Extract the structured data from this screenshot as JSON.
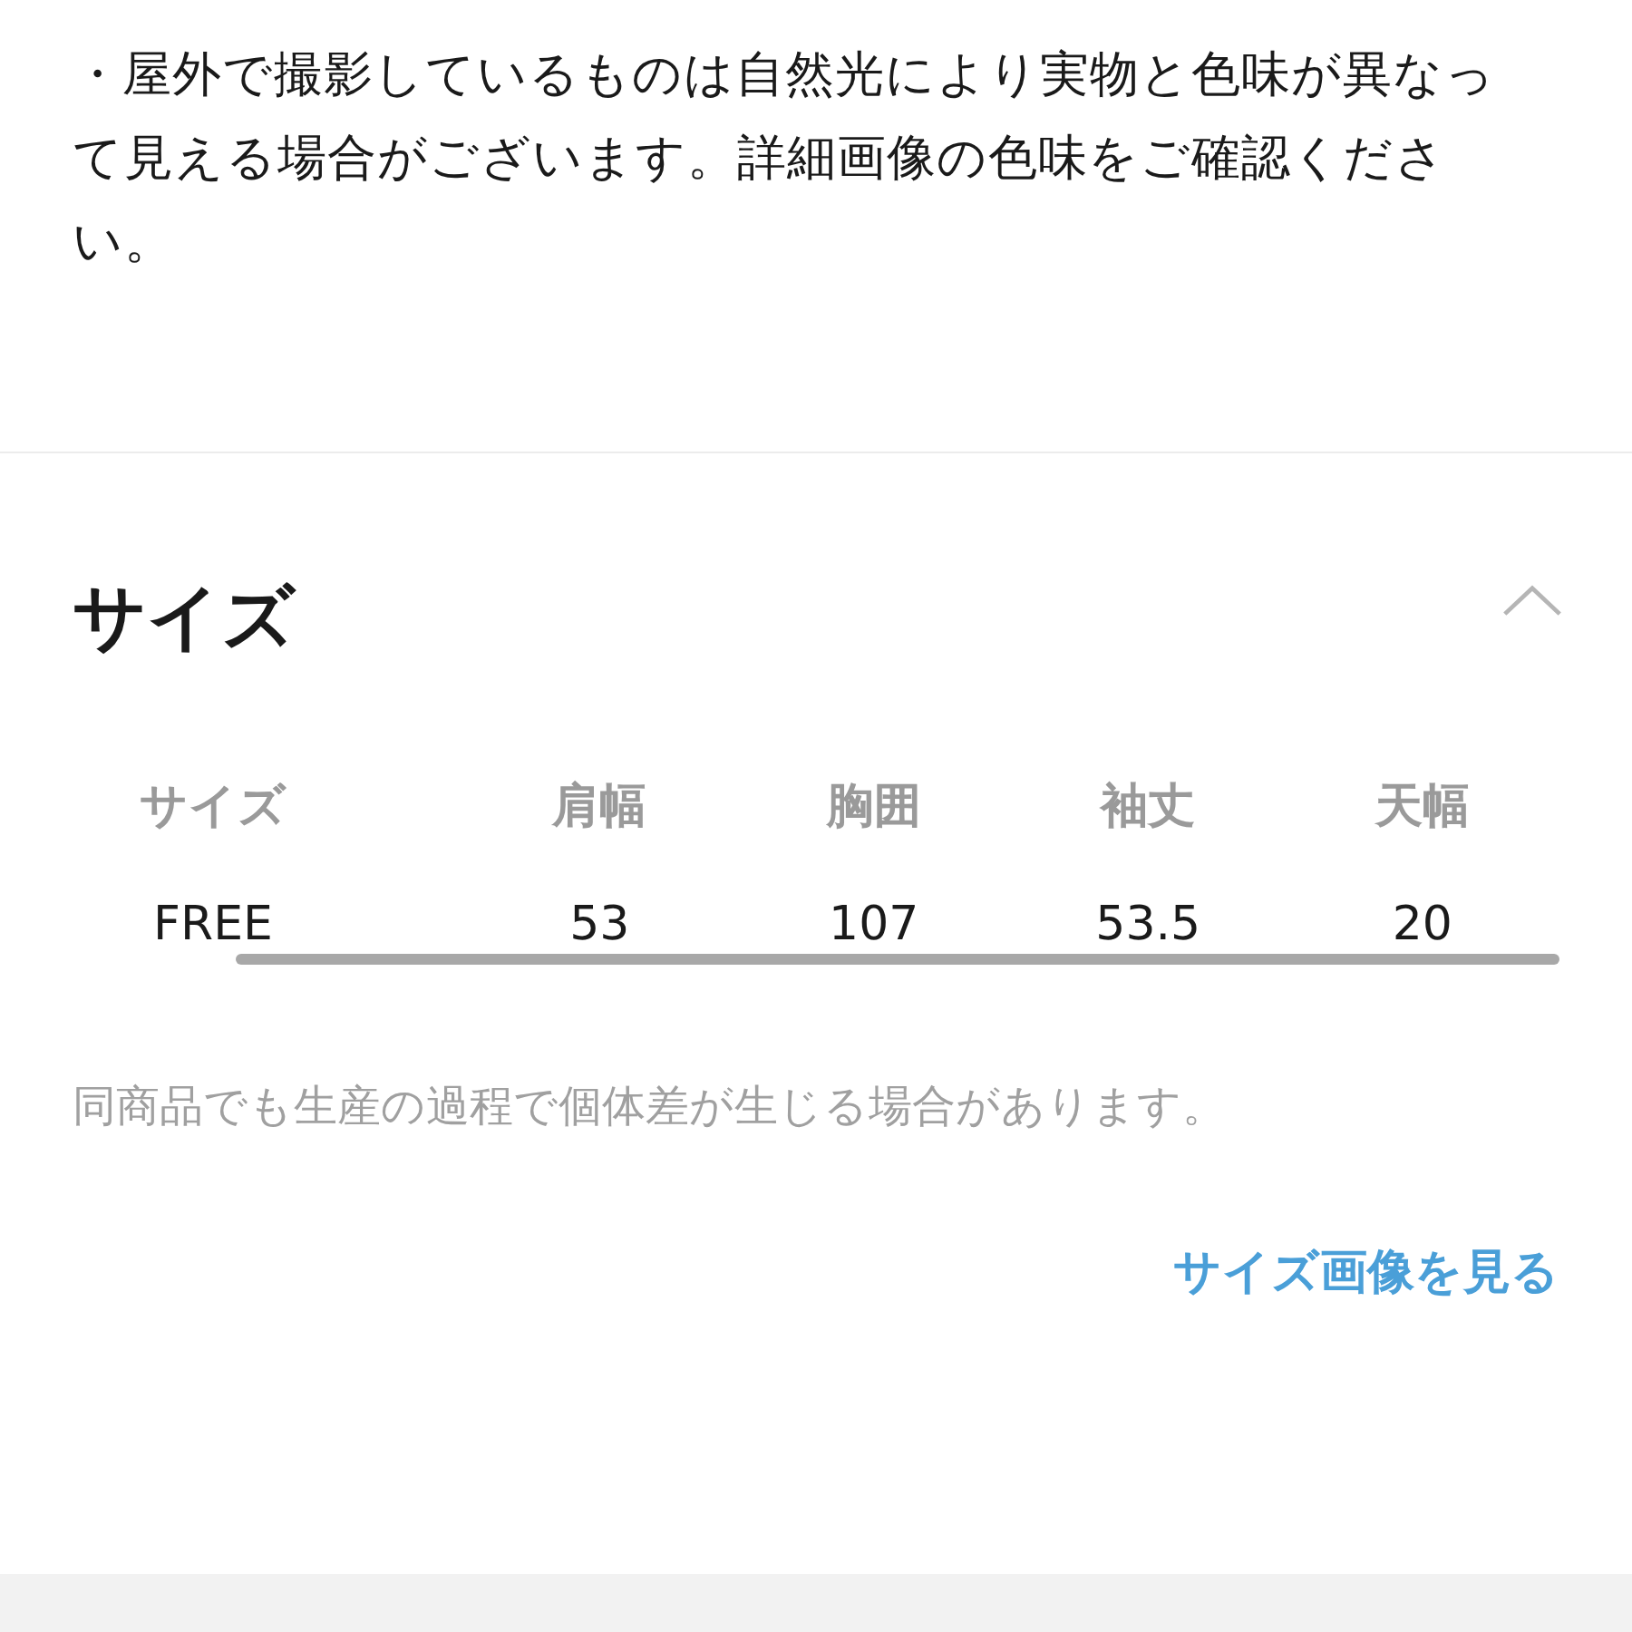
{
  "description": {
    "lines": [
      "・屋外で撮影しているものは自然光により実物と色味が異なっ",
      "て見える場合がございます。詳細画像の色味をご確認くださ",
      "い。"
    ]
  },
  "size_section": {
    "title": "サイズ",
    "expanded": true,
    "table": {
      "columns": [
        "サイズ",
        "肩幅",
        "胸囲",
        "袖丈",
        "天幅"
      ],
      "rows": [
        [
          "FREE",
          "53",
          "107",
          "53.5",
          "20"
        ]
      ]
    },
    "note": "同商品でも生産の過程で個体差が生じる場合があります。",
    "link": "サイズ画像を見る"
  }
}
